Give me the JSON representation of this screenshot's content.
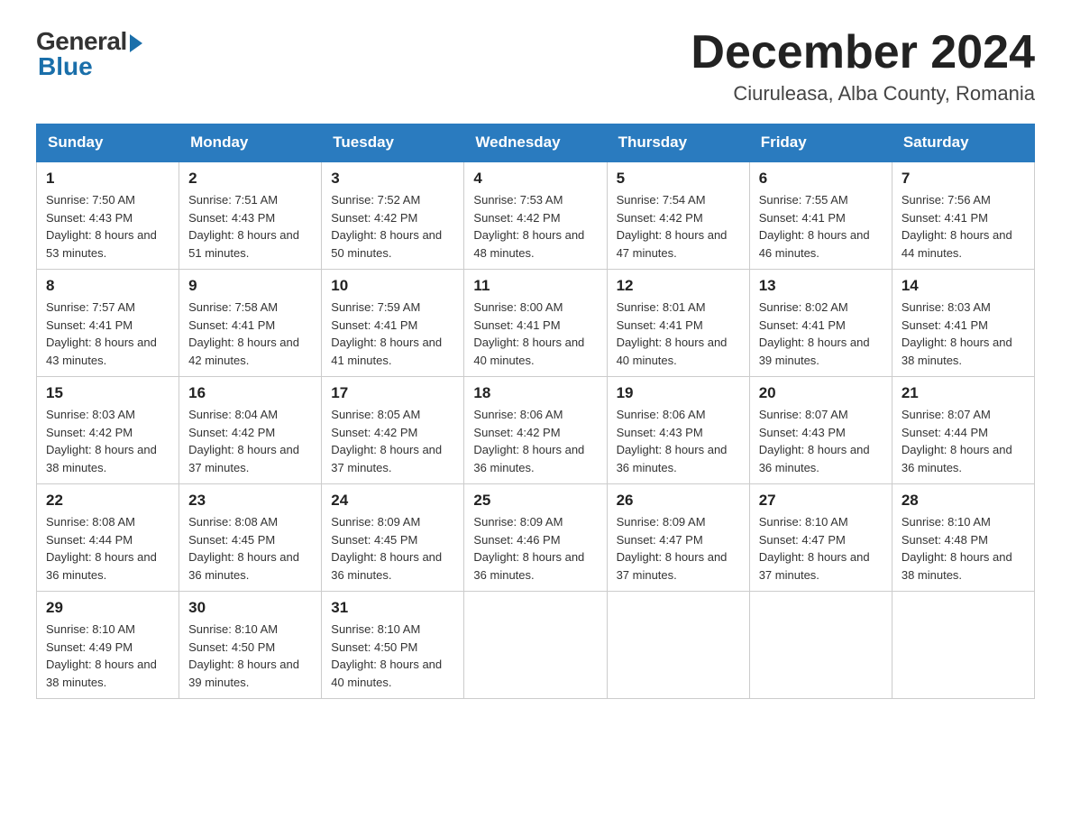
{
  "header": {
    "logo_general": "General",
    "logo_blue": "Blue",
    "month_year": "December 2024",
    "location": "Ciuruleasa, Alba County, Romania"
  },
  "days_of_week": [
    "Sunday",
    "Monday",
    "Tuesday",
    "Wednesday",
    "Thursday",
    "Friday",
    "Saturday"
  ],
  "weeks": [
    [
      {
        "day": "1",
        "sunrise": "7:50 AM",
        "sunset": "4:43 PM",
        "daylight": "8 hours and 53 minutes."
      },
      {
        "day": "2",
        "sunrise": "7:51 AM",
        "sunset": "4:43 PM",
        "daylight": "8 hours and 51 minutes."
      },
      {
        "day": "3",
        "sunrise": "7:52 AM",
        "sunset": "4:42 PM",
        "daylight": "8 hours and 50 minutes."
      },
      {
        "day": "4",
        "sunrise": "7:53 AM",
        "sunset": "4:42 PM",
        "daylight": "8 hours and 48 minutes."
      },
      {
        "day": "5",
        "sunrise": "7:54 AM",
        "sunset": "4:42 PM",
        "daylight": "8 hours and 47 minutes."
      },
      {
        "day": "6",
        "sunrise": "7:55 AM",
        "sunset": "4:41 PM",
        "daylight": "8 hours and 46 minutes."
      },
      {
        "day": "7",
        "sunrise": "7:56 AM",
        "sunset": "4:41 PM",
        "daylight": "8 hours and 44 minutes."
      }
    ],
    [
      {
        "day": "8",
        "sunrise": "7:57 AM",
        "sunset": "4:41 PM",
        "daylight": "8 hours and 43 minutes."
      },
      {
        "day": "9",
        "sunrise": "7:58 AM",
        "sunset": "4:41 PM",
        "daylight": "8 hours and 42 minutes."
      },
      {
        "day": "10",
        "sunrise": "7:59 AM",
        "sunset": "4:41 PM",
        "daylight": "8 hours and 41 minutes."
      },
      {
        "day": "11",
        "sunrise": "8:00 AM",
        "sunset": "4:41 PM",
        "daylight": "8 hours and 40 minutes."
      },
      {
        "day": "12",
        "sunrise": "8:01 AM",
        "sunset": "4:41 PM",
        "daylight": "8 hours and 40 minutes."
      },
      {
        "day": "13",
        "sunrise": "8:02 AM",
        "sunset": "4:41 PM",
        "daylight": "8 hours and 39 minutes."
      },
      {
        "day": "14",
        "sunrise": "8:03 AM",
        "sunset": "4:41 PM",
        "daylight": "8 hours and 38 minutes."
      }
    ],
    [
      {
        "day": "15",
        "sunrise": "8:03 AM",
        "sunset": "4:42 PM",
        "daylight": "8 hours and 38 minutes."
      },
      {
        "day": "16",
        "sunrise": "8:04 AM",
        "sunset": "4:42 PM",
        "daylight": "8 hours and 37 minutes."
      },
      {
        "day": "17",
        "sunrise": "8:05 AM",
        "sunset": "4:42 PM",
        "daylight": "8 hours and 37 minutes."
      },
      {
        "day": "18",
        "sunrise": "8:06 AM",
        "sunset": "4:42 PM",
        "daylight": "8 hours and 36 minutes."
      },
      {
        "day": "19",
        "sunrise": "8:06 AM",
        "sunset": "4:43 PM",
        "daylight": "8 hours and 36 minutes."
      },
      {
        "day": "20",
        "sunrise": "8:07 AM",
        "sunset": "4:43 PM",
        "daylight": "8 hours and 36 minutes."
      },
      {
        "day": "21",
        "sunrise": "8:07 AM",
        "sunset": "4:44 PM",
        "daylight": "8 hours and 36 minutes."
      }
    ],
    [
      {
        "day": "22",
        "sunrise": "8:08 AM",
        "sunset": "4:44 PM",
        "daylight": "8 hours and 36 minutes."
      },
      {
        "day": "23",
        "sunrise": "8:08 AM",
        "sunset": "4:45 PM",
        "daylight": "8 hours and 36 minutes."
      },
      {
        "day": "24",
        "sunrise": "8:09 AM",
        "sunset": "4:45 PM",
        "daylight": "8 hours and 36 minutes."
      },
      {
        "day": "25",
        "sunrise": "8:09 AM",
        "sunset": "4:46 PM",
        "daylight": "8 hours and 36 minutes."
      },
      {
        "day": "26",
        "sunrise": "8:09 AM",
        "sunset": "4:47 PM",
        "daylight": "8 hours and 37 minutes."
      },
      {
        "day": "27",
        "sunrise": "8:10 AM",
        "sunset": "4:47 PM",
        "daylight": "8 hours and 37 minutes."
      },
      {
        "day": "28",
        "sunrise": "8:10 AM",
        "sunset": "4:48 PM",
        "daylight": "8 hours and 38 minutes."
      }
    ],
    [
      {
        "day": "29",
        "sunrise": "8:10 AM",
        "sunset": "4:49 PM",
        "daylight": "8 hours and 38 minutes."
      },
      {
        "day": "30",
        "sunrise": "8:10 AM",
        "sunset": "4:50 PM",
        "daylight": "8 hours and 39 minutes."
      },
      {
        "day": "31",
        "sunrise": "8:10 AM",
        "sunset": "4:50 PM",
        "daylight": "8 hours and 40 minutes."
      },
      null,
      null,
      null,
      null
    ]
  ],
  "labels": {
    "sunrise": "Sunrise:",
    "sunset": "Sunset:",
    "daylight": "Daylight:"
  }
}
